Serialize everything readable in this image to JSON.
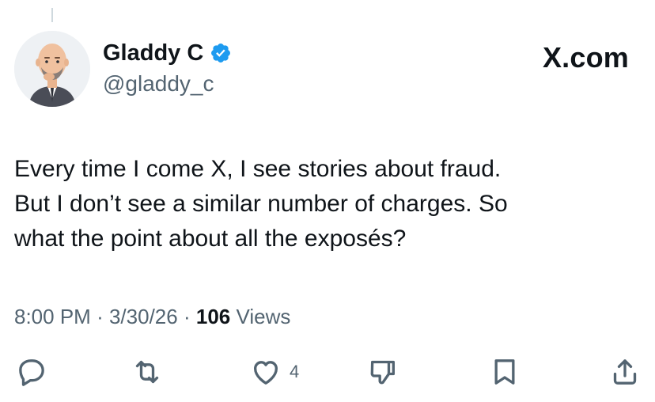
{
  "author": {
    "display_name": "Gladdy C",
    "handle": "@gladdy_c",
    "verified": true
  },
  "site_label": "X.com",
  "tweet": {
    "lines": [
      "Every time I come X, I see stories about fraud.",
      "But I don’t see a similar number of charges. So",
      "what the point about all the exposés?"
    ]
  },
  "meta": {
    "time": "8:00 PM",
    "separator": "·",
    "date": "3/30/26",
    "views_count": "106",
    "views_label": "Views"
  },
  "actions": {
    "reply_count": "",
    "repost_count": "",
    "like_count": "4",
    "dislike_count": "",
    "icons": [
      "reply-icon",
      "repost-icon",
      "like-icon",
      "dislike-icon",
      "bookmark-icon",
      "share-icon"
    ]
  },
  "colors": {
    "text": "#0f1419",
    "secondary": "#536471",
    "verified": "#1d9bf0"
  }
}
